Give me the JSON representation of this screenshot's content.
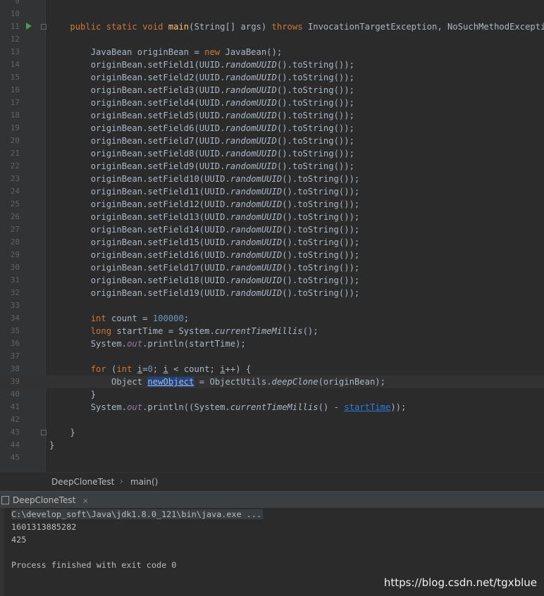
{
  "editor": {
    "lines": [
      {
        "n": "9",
        "html": ""
      },
      {
        "n": "10",
        "html": ""
      },
      {
        "n": "11",
        "html": "    <span class=\"kw\">public static void</span> <span class=\"fn\">main</span>(String[] args) <span class=\"kw\">throws</span> InvocationTargetException, NoSuchMethodException"
      },
      {
        "n": "12",
        "html": ""
      },
      {
        "n": "13",
        "html": "        JavaBean originBean = <span class=\"kw\">new</span> JavaBean();"
      },
      {
        "n": "14",
        "html": "        originBean.setField1(UUID.<span class=\"it\">randomUUID</span>().toString());"
      },
      {
        "n": "15",
        "html": "        originBean.setField2(UUID.<span class=\"it\">randomUUID</span>().toString());"
      },
      {
        "n": "16",
        "html": "        originBean.setField3(UUID.<span class=\"it\">randomUUID</span>().toString());"
      },
      {
        "n": "17",
        "html": "        originBean.setField4(UUID.<span class=\"it\">randomUUID</span>().toString());"
      },
      {
        "n": "18",
        "html": "        originBean.setField5(UUID.<span class=\"it\">randomUUID</span>().toString());"
      },
      {
        "n": "19",
        "html": "        originBean.setField6(UUID.<span class=\"it\">randomUUID</span>().toString());"
      },
      {
        "n": "20",
        "html": "        originBean.setField7(UUID.<span class=\"it\">randomUUID</span>().toString());"
      },
      {
        "n": "21",
        "html": "        originBean.setField8(UUID.<span class=\"it\">randomUUID</span>().toString());"
      },
      {
        "n": "22",
        "html": "        originBean.setField9(UUID.<span class=\"it\">randomUUID</span>().toString());"
      },
      {
        "n": "23",
        "html": "        originBean.setField10(UUID.<span class=\"it\">randomUUID</span>().toString());"
      },
      {
        "n": "24",
        "html": "        originBean.setField11(UUID.<span class=\"it\">randomUUID</span>().toString());"
      },
      {
        "n": "25",
        "html": "        originBean.setField12(UUID.<span class=\"it\">randomUUID</span>().toString());"
      },
      {
        "n": "26",
        "html": "        originBean.setField13(UUID.<span class=\"it\">randomUUID</span>().toString());"
      },
      {
        "n": "27",
        "html": "        originBean.setField14(UUID.<span class=\"it\">randomUUID</span>().toString());"
      },
      {
        "n": "28",
        "html": "        originBean.setField15(UUID.<span class=\"it\">randomUUID</span>().toString());"
      },
      {
        "n": "29",
        "html": "        originBean.setField16(UUID.<span class=\"it\">randomUUID</span>().toString());"
      },
      {
        "n": "30",
        "html": "        originBean.setField17(UUID.<span class=\"it\">randomUUID</span>().toString());"
      },
      {
        "n": "31",
        "html": "        originBean.setField18(UUID.<span class=\"it\">randomUUID</span>().toString());"
      },
      {
        "n": "32",
        "html": "        originBean.setField19(UUID.<span class=\"it\">randomUUID</span>().toString());"
      },
      {
        "n": "33",
        "html": ""
      },
      {
        "n": "34",
        "html": "        <span class=\"kw\">int</span> count = <span class=\"num\">100000</span>;"
      },
      {
        "n": "35",
        "html": "        <span class=\"kw\">long</span> startTime = System.<span class=\"it\">currentTimeMillis</span>();"
      },
      {
        "n": "36",
        "html": "        System.<span class=\"fld it\">out</span>.println(startTime);"
      },
      {
        "n": "37",
        "html": ""
      },
      {
        "n": "38",
        "html": "        <span class=\"kw\">for</span> (<span class=\"kw\">int</span> <span class=\"ul\">i</span>=<span class=\"num\">0</span>; <span class=\"ul\">i</span> &lt; count; <span class=\"ul\">i</span>++) {"
      },
      {
        "n": "39",
        "html": "            Object <span class=\"hl\">newObject</span> = ObjectUtils.<span class=\"it\">deepClone</span>(originBean);"
      },
      {
        "n": "40",
        "html": "        }"
      },
      {
        "n": "41",
        "html": "        System.<span class=\"fld it\">out</span>.println((System.<span class=\"it\">currentTimeMillis</span>() - <span class=\"link\">startTime</span>));"
      },
      {
        "n": "42",
        "html": ""
      },
      {
        "n": "43",
        "html": "    }"
      },
      {
        "n": "44",
        "html": "}"
      },
      {
        "n": "45",
        "html": ""
      }
    ]
  },
  "breadcrumbs": {
    "class_name": "DeepCloneTest",
    "separator": "›",
    "method_name": "main()"
  },
  "run_tab": {
    "label": "DeepCloneTest",
    "close": "×"
  },
  "console": {
    "command": "C:\\develop_soft\\Java\\jdk1.8.0_121\\bin\\java.exe ...",
    "output_1": "1601313885282",
    "output_2": "425",
    "blank": "",
    "finish": "Process finished with exit code 0"
  },
  "watermark": "https://blog.csdn.net/tgxblue",
  "colors": {
    "background": "#2b2b2b",
    "keyword": "#cc7832",
    "number": "#6897bb",
    "method_decl": "#ffc66d",
    "selection": "#214283"
  },
  "icons": [
    "run-gutter-icon",
    "fold-icon",
    "console-tab-icon",
    "close-icon"
  ]
}
